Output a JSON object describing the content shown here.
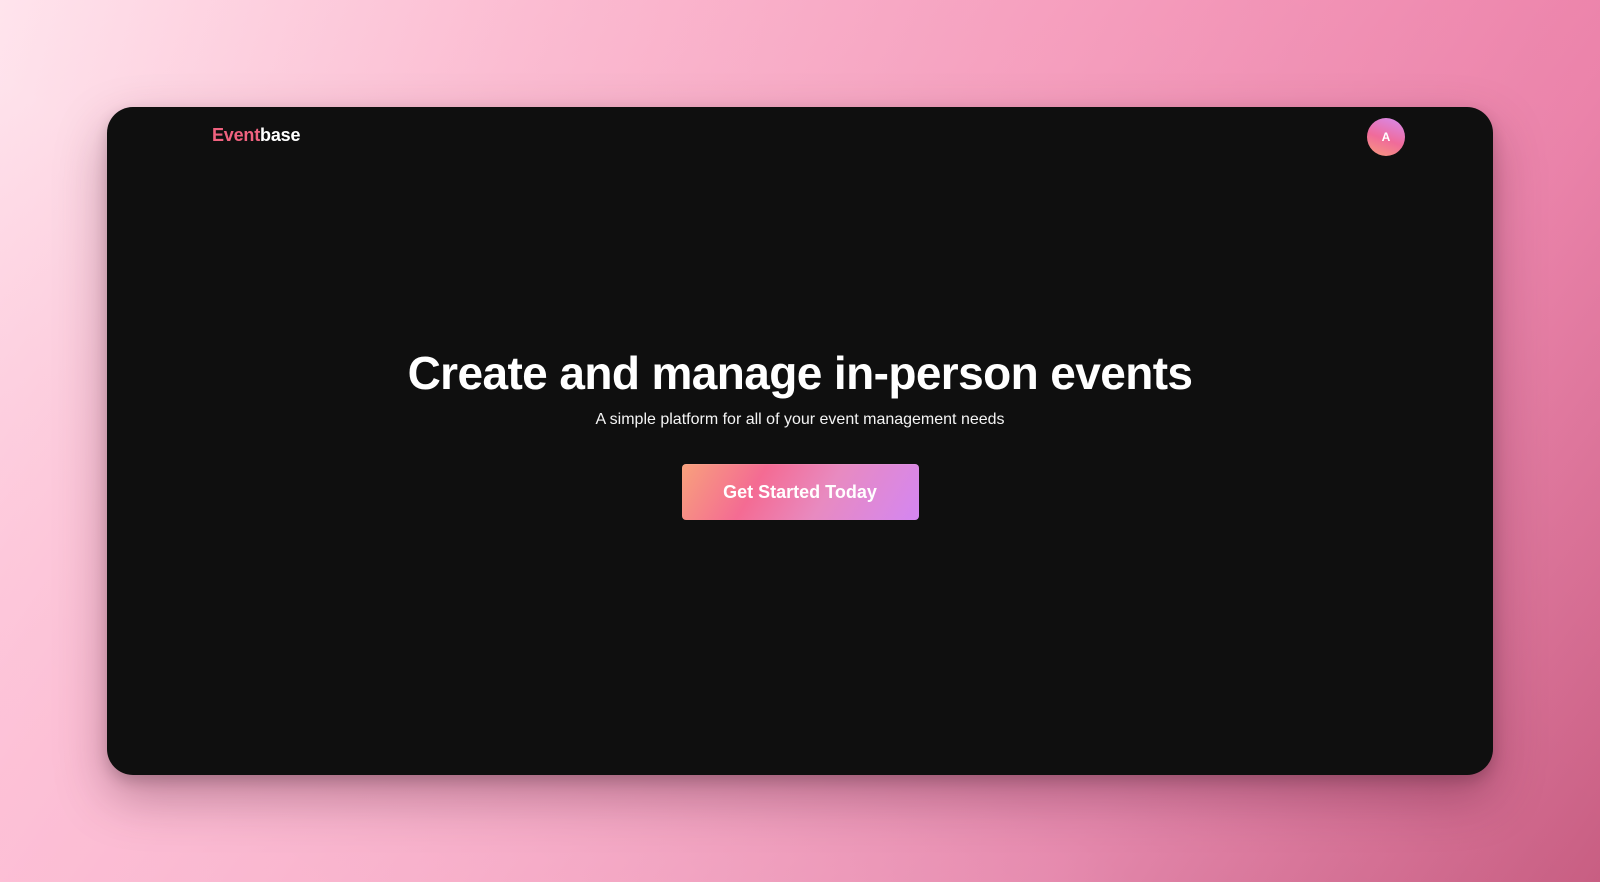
{
  "brand": {
    "accent_text": "Event",
    "rest_text": "base",
    "accent_color": "#f0627f"
  },
  "user": {
    "avatar_initial": "A"
  },
  "hero": {
    "title": "Create and manage in-person events",
    "subtitle": "A simple platform for all of your event management needs",
    "cta_label": "Get Started Today"
  },
  "colors": {
    "window_background": "#0f0f0f",
    "cta_gradient": [
      "#f8a17c",
      "#f46b93",
      "#d486f2"
    ],
    "page_background": [
      "#ffe6ee",
      "#f3a7c3",
      "#c45d80"
    ]
  }
}
